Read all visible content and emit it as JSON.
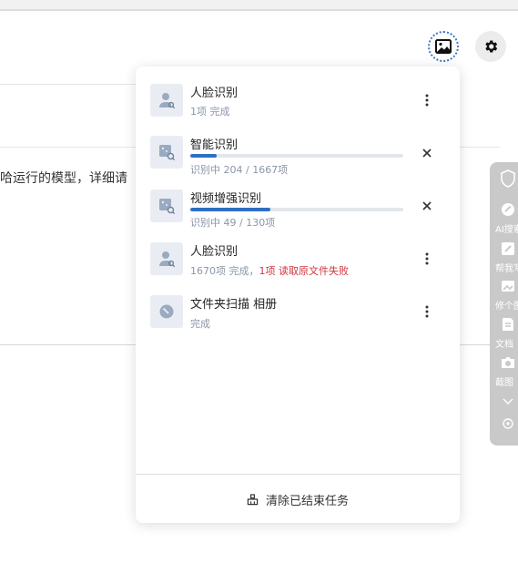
{
  "background": {
    "text": "哈运行的模型，详细请"
  },
  "header": {
    "photo_button_icon": "image-icon",
    "settings_button_icon": "gear-icon"
  },
  "tasks": [
    {
      "title": "人脸识别",
      "subtitle": "1项 完成",
      "type": "face",
      "action": "more"
    },
    {
      "title": "智能识别",
      "subtitle": "识别中 204 / 1667项",
      "type": "smart",
      "progress": 0.122,
      "action": "close"
    },
    {
      "title": "视频增强识别",
      "subtitle": "识别中 49 / 130项",
      "type": "smart",
      "progress": 0.377,
      "action": "close"
    },
    {
      "title": "人脸识别",
      "subtitle": "1670项 完成，",
      "error": "1项 读取原文件失败",
      "type": "face",
      "action": "more"
    },
    {
      "title": "文件夹扫描 相册",
      "subtitle": "完成",
      "type": "scan",
      "action": "more"
    }
  ],
  "footer": {
    "clear_label": "清除已结束任务"
  },
  "side_toolbar": {
    "items": [
      "AI搜索",
      "帮我写",
      "修个图",
      "文档",
      "截图"
    ]
  },
  "colors": {
    "accent": "#2f6fc2",
    "error": "#d0353f",
    "muted": "#8a96a8"
  }
}
